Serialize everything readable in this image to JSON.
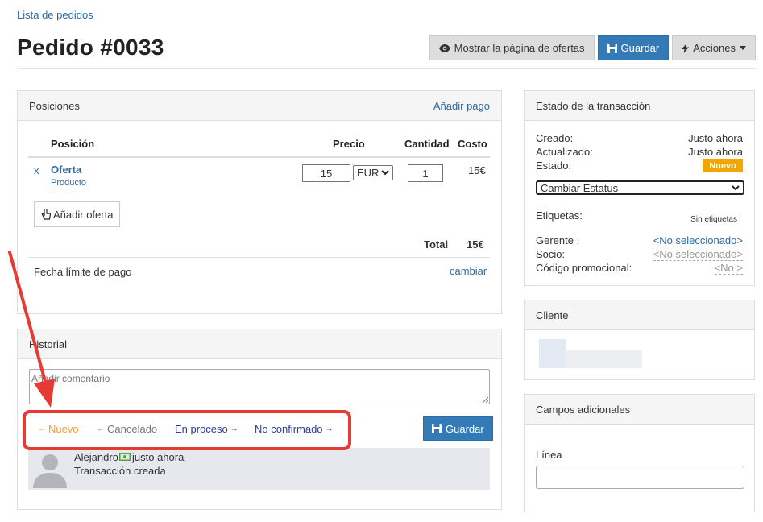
{
  "breadcrumb": {
    "label": "Lista de pedidos"
  },
  "page": {
    "title": "Pedido #0033"
  },
  "top_actions": {
    "show_offers": "Mostrar la página de ofertas",
    "save": "Guardar",
    "actions": "Acciones"
  },
  "positions_panel": {
    "title": "Posiciones",
    "add_payment": "Añadir pago",
    "columns": {
      "position": "Posición",
      "price": "Precio",
      "quantity": "Cantidad",
      "cost": "Costo"
    },
    "item": {
      "remove": "x",
      "name": "Oferta",
      "type": "Producto",
      "price": "15",
      "currency": "EUR",
      "quantity": "1",
      "cost": "15€"
    },
    "add_offer": "Añadir oferta",
    "total_label": "Total",
    "total_value": "15€",
    "due_date_label": "Fecha límite de pago",
    "due_date_change": "cambiar"
  },
  "history_panel": {
    "title": "Historial",
    "comment_placeholder": "Añadir comentario",
    "status_links": [
      {
        "label": "Nuevo",
        "dir": "back",
        "color": "#f0a030"
      },
      {
        "label": "Cancelado",
        "dir": "back",
        "color": "#777777"
      },
      {
        "label": "En proceso",
        "dir": "fwd",
        "color": "#2b3a9c"
      },
      {
        "label": "No confirmado",
        "dir": "fwd",
        "color": "#2b3a9c"
      }
    ],
    "save": "Guardar",
    "entry": {
      "author": "Alejandro",
      "time": "justo ahora",
      "text": "Transacción creada"
    }
  },
  "transaction_panel": {
    "title": "Estado de la transacción",
    "created_label": "Creado:",
    "created_value": "Justo ahora",
    "updated_label": "Actualizado:",
    "updated_value": "Justo ahora",
    "status_label": "Estado:",
    "status_badge": "Nuevo",
    "status_badge_color": "#f0a500",
    "change_status": "Cambiar Estatus",
    "tags_label": "Etiquetas:",
    "tags_value": "Sin etiquetas",
    "manager_label": "Gerente :",
    "manager_value": "<No seleccionado>",
    "partner_label": "Socio:",
    "partner_value": "<No seleccionado>",
    "promo_label": "Código promocional:",
    "promo_value": "<No >"
  },
  "client_panel": {
    "title": "Cliente"
  },
  "extra_panel": {
    "title": "Campos adicionales",
    "line_label": "Línea"
  }
}
